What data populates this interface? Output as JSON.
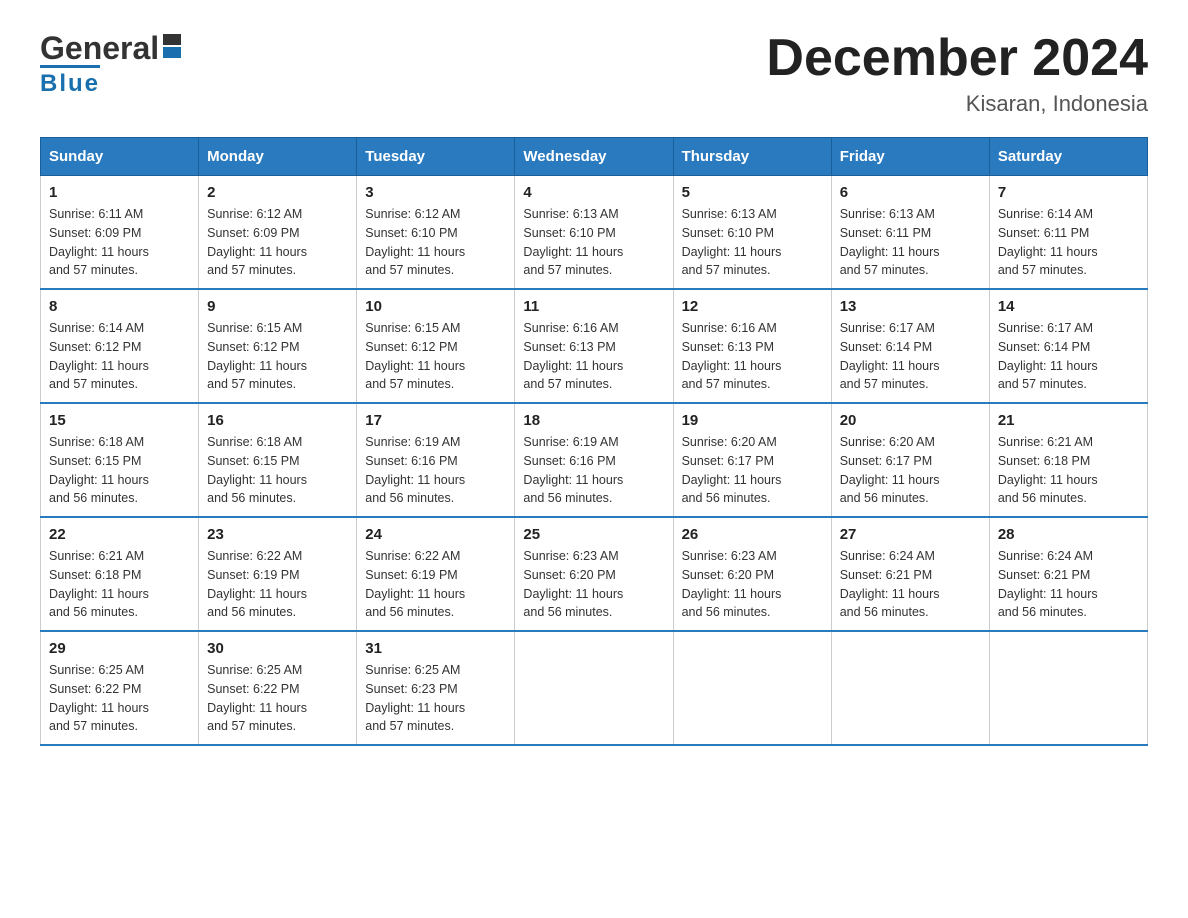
{
  "header": {
    "logo_general": "General",
    "logo_blue": "Blue",
    "title": "December 2024",
    "subtitle": "Kisaran, Indonesia"
  },
  "days_header": [
    "Sunday",
    "Monday",
    "Tuesday",
    "Wednesday",
    "Thursday",
    "Friday",
    "Saturday"
  ],
  "weeks": [
    [
      {
        "day": "1",
        "sunrise": "6:11 AM",
        "sunset": "6:09 PM",
        "daylight": "11 hours and 57 minutes."
      },
      {
        "day": "2",
        "sunrise": "6:12 AM",
        "sunset": "6:09 PM",
        "daylight": "11 hours and 57 minutes."
      },
      {
        "day": "3",
        "sunrise": "6:12 AM",
        "sunset": "6:10 PM",
        "daylight": "11 hours and 57 minutes."
      },
      {
        "day": "4",
        "sunrise": "6:13 AM",
        "sunset": "6:10 PM",
        "daylight": "11 hours and 57 minutes."
      },
      {
        "day": "5",
        "sunrise": "6:13 AM",
        "sunset": "6:10 PM",
        "daylight": "11 hours and 57 minutes."
      },
      {
        "day": "6",
        "sunrise": "6:13 AM",
        "sunset": "6:11 PM",
        "daylight": "11 hours and 57 minutes."
      },
      {
        "day": "7",
        "sunrise": "6:14 AM",
        "sunset": "6:11 PM",
        "daylight": "11 hours and 57 minutes."
      }
    ],
    [
      {
        "day": "8",
        "sunrise": "6:14 AM",
        "sunset": "6:12 PM",
        "daylight": "11 hours and 57 minutes."
      },
      {
        "day": "9",
        "sunrise": "6:15 AM",
        "sunset": "6:12 PM",
        "daylight": "11 hours and 57 minutes."
      },
      {
        "day": "10",
        "sunrise": "6:15 AM",
        "sunset": "6:12 PM",
        "daylight": "11 hours and 57 minutes."
      },
      {
        "day": "11",
        "sunrise": "6:16 AM",
        "sunset": "6:13 PM",
        "daylight": "11 hours and 57 minutes."
      },
      {
        "day": "12",
        "sunrise": "6:16 AM",
        "sunset": "6:13 PM",
        "daylight": "11 hours and 57 minutes."
      },
      {
        "day": "13",
        "sunrise": "6:17 AM",
        "sunset": "6:14 PM",
        "daylight": "11 hours and 57 minutes."
      },
      {
        "day": "14",
        "sunrise": "6:17 AM",
        "sunset": "6:14 PM",
        "daylight": "11 hours and 57 minutes."
      }
    ],
    [
      {
        "day": "15",
        "sunrise": "6:18 AM",
        "sunset": "6:15 PM",
        "daylight": "11 hours and 56 minutes."
      },
      {
        "day": "16",
        "sunrise": "6:18 AM",
        "sunset": "6:15 PM",
        "daylight": "11 hours and 56 minutes."
      },
      {
        "day": "17",
        "sunrise": "6:19 AM",
        "sunset": "6:16 PM",
        "daylight": "11 hours and 56 minutes."
      },
      {
        "day": "18",
        "sunrise": "6:19 AM",
        "sunset": "6:16 PM",
        "daylight": "11 hours and 56 minutes."
      },
      {
        "day": "19",
        "sunrise": "6:20 AM",
        "sunset": "6:17 PM",
        "daylight": "11 hours and 56 minutes."
      },
      {
        "day": "20",
        "sunrise": "6:20 AM",
        "sunset": "6:17 PM",
        "daylight": "11 hours and 56 minutes."
      },
      {
        "day": "21",
        "sunrise": "6:21 AM",
        "sunset": "6:18 PM",
        "daylight": "11 hours and 56 minutes."
      }
    ],
    [
      {
        "day": "22",
        "sunrise": "6:21 AM",
        "sunset": "6:18 PM",
        "daylight": "11 hours and 56 minutes."
      },
      {
        "day": "23",
        "sunrise": "6:22 AM",
        "sunset": "6:19 PM",
        "daylight": "11 hours and 56 minutes."
      },
      {
        "day": "24",
        "sunrise": "6:22 AM",
        "sunset": "6:19 PM",
        "daylight": "11 hours and 56 minutes."
      },
      {
        "day": "25",
        "sunrise": "6:23 AM",
        "sunset": "6:20 PM",
        "daylight": "11 hours and 56 minutes."
      },
      {
        "day": "26",
        "sunrise": "6:23 AM",
        "sunset": "6:20 PM",
        "daylight": "11 hours and 56 minutes."
      },
      {
        "day": "27",
        "sunrise": "6:24 AM",
        "sunset": "6:21 PM",
        "daylight": "11 hours and 56 minutes."
      },
      {
        "day": "28",
        "sunrise": "6:24 AM",
        "sunset": "6:21 PM",
        "daylight": "11 hours and 56 minutes."
      }
    ],
    [
      {
        "day": "29",
        "sunrise": "6:25 AM",
        "sunset": "6:22 PM",
        "daylight": "11 hours and 57 minutes."
      },
      {
        "day": "30",
        "sunrise": "6:25 AM",
        "sunset": "6:22 PM",
        "daylight": "11 hours and 57 minutes."
      },
      {
        "day": "31",
        "sunrise": "6:25 AM",
        "sunset": "6:23 PM",
        "daylight": "11 hours and 57 minutes."
      },
      null,
      null,
      null,
      null
    ]
  ],
  "labels": {
    "sunrise": "Sunrise:",
    "sunset": "Sunset:",
    "daylight": "Daylight:"
  }
}
